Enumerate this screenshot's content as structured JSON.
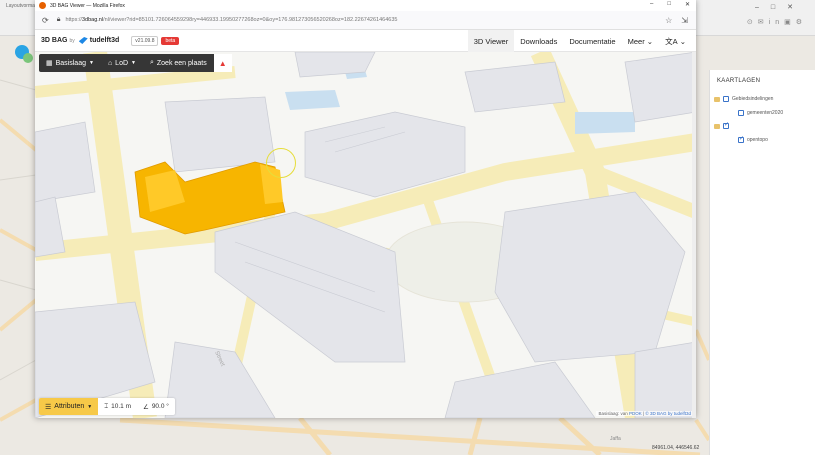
{
  "background": {
    "window_title": "Layoutvormaagt...",
    "coords": "84961.04, 446546.62",
    "map_label_jaffa": "Jaffa"
  },
  "panel": {
    "title": "KAARTLAGEN",
    "layers": [
      {
        "label": "Gebiedsindelingen",
        "checked": false,
        "type": "group"
      },
      {
        "label": "gemeenten2020",
        "checked": false,
        "type": "layer"
      },
      {
        "label": "",
        "checked": true,
        "type": "group"
      },
      {
        "label": "opentopo",
        "checked": true,
        "type": "layer"
      }
    ]
  },
  "window": {
    "title": "3D BAG Viewer — Mozilla Firefox",
    "url_prefix": "https://",
    "url_host": "3dbag.nl",
    "url_rest": "/nl/viewer?rid=85101.726064559298ry=446933.19950277268oz=0&oy=176.981273056520268oz=182.22674261464635",
    "btn_minimize": "–",
    "btn_maximize": "□",
    "btn_close": "✕"
  },
  "app": {
    "logo": "3D BAG",
    "logo_by": "by",
    "org": "tudelft3d",
    "version": "v21.09.8",
    "beta": "beta",
    "menu": [
      "3D Viewer",
      "Downloads",
      "Documentatie",
      "Meer"
    ],
    "lang_icon": "translate-icon"
  },
  "toolbar": {
    "basislaag": "Basislaag",
    "lod": "LoD",
    "search": "Zoek een plaats",
    "alert": "▲"
  },
  "bottombar": {
    "attributen": "Attributen",
    "height": "10.1 m",
    "angle": "90.0 °"
  },
  "attribution": {
    "prefix": "Basislaag: van ",
    "pdok": "PDOK",
    "sep": " | ",
    "bag": "© 3D BAG by tudelft3d"
  },
  "colors": {
    "selected_building": "#f7b500",
    "building": "#e4e5ea",
    "road": "#f6ecb8",
    "water": "#c9dff0",
    "toolbar": "#363636",
    "beta": "#e53935"
  }
}
